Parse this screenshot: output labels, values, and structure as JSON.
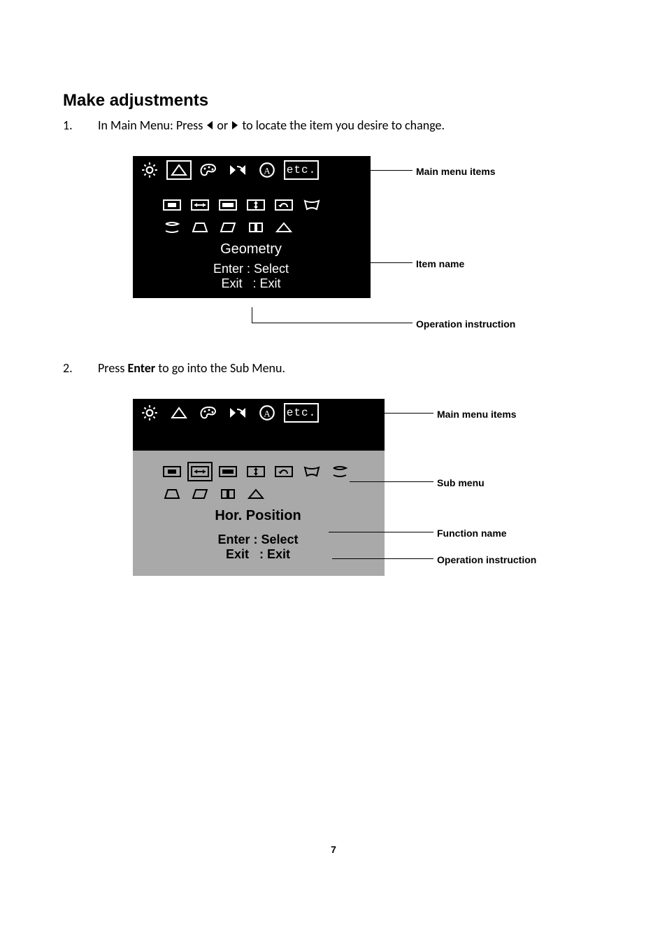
{
  "heading": "Make adjustments",
  "steps": {
    "s1_num": "1.",
    "s1_before": "In Main Menu: Press  ",
    "s1_mid": "  or  ",
    "s1_after": "  to locate the item you desire to change.",
    "s2_num": "2.",
    "s2_before": "Press ",
    "s2_bold": "Enter",
    "s2_after": " to go into the Sub Menu."
  },
  "osd1": {
    "etc": "etc.",
    "item_name": "Geometry",
    "ops_line1": "Enter : Select",
    "ops_line2": "Exit   : Exit"
  },
  "osd2": {
    "etc": "etc.",
    "item_name": "Hor. Position",
    "ops_line1": "Enter : Select",
    "ops_line2": "Exit   : Exit"
  },
  "annotations": {
    "a_main": "Main menu items",
    "a_item": "Item name",
    "a_op": "Operation instruction",
    "a_sub": "Sub menu",
    "a_fn": "Function name"
  },
  "page_number": "7"
}
